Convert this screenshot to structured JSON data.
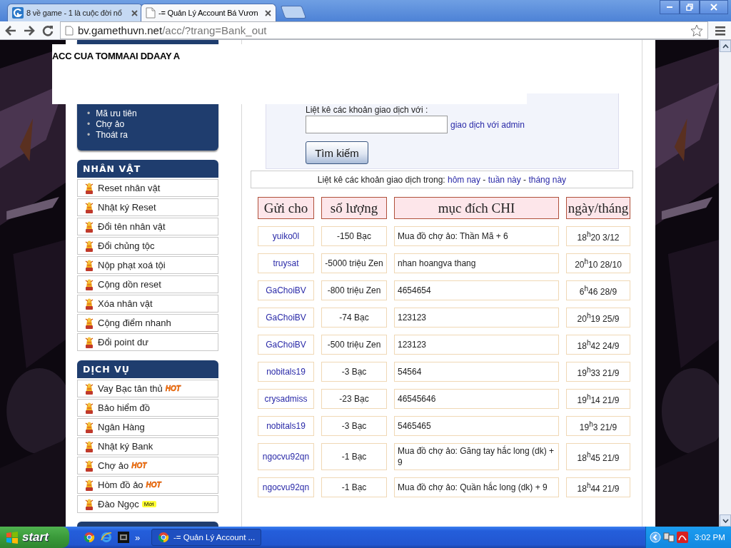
{
  "browser": {
    "tabs": [
      {
        "title": "8 về game - 1 là cuộc đời nổ",
        "selected": false
      },
      {
        "title": "-= Quản Lý Account Bá Vươn",
        "selected": true
      }
    ],
    "address": {
      "host": "bv.gamethuvn.net",
      "path": "/acc/?trang=Bank_out"
    }
  },
  "overlay": {
    "text": "ACC CUA TOMMAAI DDAAY A"
  },
  "sidebar": {
    "bullet": "•",
    "account_links": [
      "Mã ưu tiên",
      "Chợ ảo",
      "Thoát ra"
    ],
    "sections": [
      {
        "title": "NHÂN VẬT",
        "items": [
          {
            "label": "Reset nhân vật"
          },
          {
            "label": "Nhật ký Reset"
          },
          {
            "label": "Đổi tên nhân vật"
          },
          {
            "label": "Đổi chủng tộc"
          },
          {
            "label": "Nộp phạt xoá tội"
          },
          {
            "label": "Cộng dồn reset"
          },
          {
            "label": "Xóa nhân vật"
          },
          {
            "label": "Cộng điểm nhanh"
          },
          {
            "label": "Đổi point dư"
          }
        ]
      },
      {
        "title": "DỊCH VỤ",
        "items": [
          {
            "label": "Vay Bạc tân thủ",
            "badge": {
              "kind": "hot",
              "text": "HOT"
            }
          },
          {
            "label": "Bảo hiểm đồ"
          },
          {
            "label": "Ngân Hàng"
          },
          {
            "label": "Nhật ký Bank"
          },
          {
            "label": "Chợ ảo",
            "badge": {
              "kind": "hot",
              "text": "HOT"
            }
          },
          {
            "label": "Hòm đồ ảo",
            "badge": {
              "kind": "hot",
              "text": "HOT"
            }
          },
          {
            "label": "Đào Ngọc",
            "badge": {
              "kind": "new",
              "text": "Mới"
            }
          }
        ]
      }
    ]
  },
  "search": {
    "label": "Liệt kê các khoản giao dịch với :",
    "admin_link": "giao dịch với admin",
    "button": "Tìm kiếm"
  },
  "period": {
    "label": "Liệt kê các khoản giao dịch trong:",
    "links": [
      "hôm nay",
      "tuần này",
      "tháng này"
    ],
    "separator": "-"
  },
  "table": {
    "columns": [
      "Gửi cho",
      "số lượng",
      "mục đích CHI",
      "ngày/tháng"
    ],
    "rows": [
      {
        "to": "yuiko0l",
        "amount": "-150 Bạc",
        "purpose": "Mua đồ chợ ảo: Thần Mã + 6",
        "date": "18$^{h}$20 3/12"
      },
      {
        "to": "truysat",
        "amount": "-5000 triệu Zen",
        "purpose": "nhan hoangva thang",
        "date": "20$^{h}$10 28/10"
      },
      {
        "to": "GaChoiBV",
        "amount": "-800 triệu Zen",
        "purpose": "4654654",
        "date": "6$^{h}$46 28/9"
      },
      {
        "to": "GaChoiBV",
        "amount": "-74 Bạc",
        "purpose": "123123",
        "date": "20$^{h}$19 25/9"
      },
      {
        "to": "GaChoiBV",
        "amount": "-500 triệu Zen",
        "purpose": "123123",
        "date": "18$^{h}$42 24/9"
      },
      {
        "to": "nobitals19",
        "amount": "-3 Bạc",
        "purpose": "54564",
        "date": "19$^{h}$33 21/9"
      },
      {
        "to": "crysadmiss",
        "amount": "-23 Bạc",
        "purpose": "46545646",
        "date": "19$^{h}$14 21/9"
      },
      {
        "to": "nobitals19",
        "amount": "-3 Bạc",
        "purpose": "5465465",
        "date": "19$^{h}$3 21/9"
      },
      {
        "to": "ngocvu92qn",
        "amount": "-1 Bạc",
        "purpose": "Mua đồ chợ ảo: Găng tay hắc long (dk) + 9",
        "date": "18$^{h}$45 21/9"
      },
      {
        "to": "ngocvu92qn",
        "amount": "-1 Bạc",
        "purpose": "Mua đồ chợ ảo: Quần hắc long (dk) + 9",
        "date": "18$^{h}$44 21/9"
      }
    ]
  },
  "taskbar": {
    "start": "start",
    "more": "»",
    "task": "-= Quản Lý Account ...",
    "clock": "3:02 PM"
  }
}
